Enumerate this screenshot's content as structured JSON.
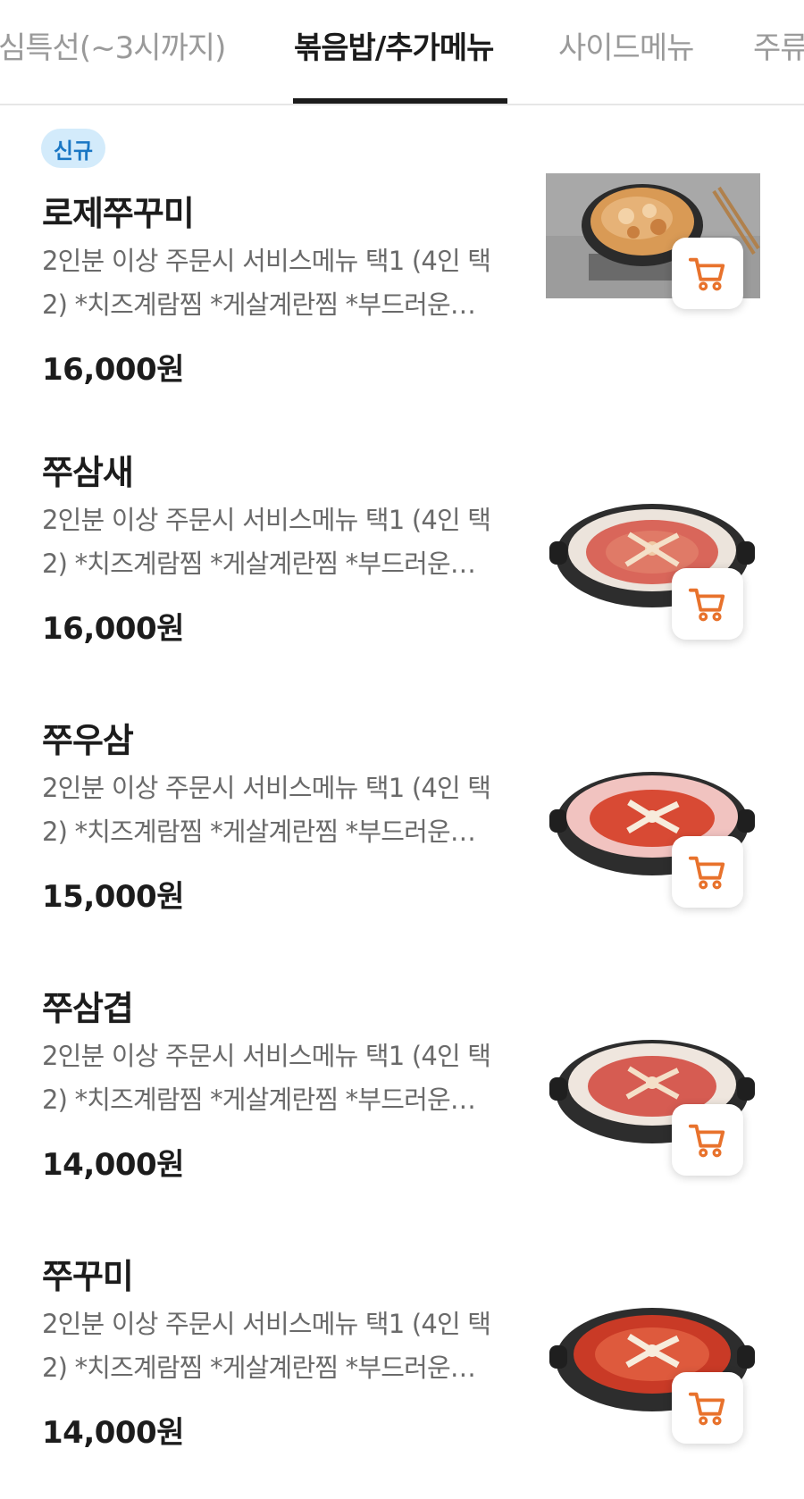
{
  "tabs": [
    {
      "label": "심특선(~3시까지)",
      "active": false
    },
    {
      "label": "볶음밥/추가메뉴",
      "active": true
    },
    {
      "label": "사이드메뉴",
      "active": false
    },
    {
      "label": "주류",
      "active": false
    }
  ],
  "colors": {
    "accent": "#e8722c",
    "badge_bg": "#d3ebfb",
    "badge_text": "#1a77c4",
    "active_tab": "#1b1b1b",
    "inactive_tab": "#9a9a9a"
  },
  "menu": {
    "items": [
      {
        "badge": "신규",
        "name": "로제쭈꾸미",
        "desc_line1": "2인분 이상 주문시 서비스메뉴 택1 (4인 택",
        "desc_line2": "2) *치즈계람찜 *게살계란찜 *부드러운…",
        "price": "16,000원",
        "image_icon": "rose-jjukkumi-dish-image",
        "cart_icon": "cart-icon"
      },
      {
        "name": "쭈삼새",
        "desc_line1": "2인분 이상 주문시 서비스메뉴 택1 (4인 택",
        "desc_line2": "2) *치즈계람찜 *게살계란찜 *부드러운…",
        "price": "16,000원",
        "image_icon": "jjusamsae-dish-image",
        "cart_icon": "cart-icon"
      },
      {
        "name": "쭈우삼",
        "desc_line1": "2인분 이상 주문시 서비스메뉴 택1 (4인 택",
        "desc_line2": "2) *치즈계람찜 *게살계란찜 *부드러운…",
        "price": "15,000원",
        "image_icon": "jjuusam-dish-image",
        "cart_icon": "cart-icon"
      },
      {
        "name": "쭈삼겹",
        "desc_line1": "2인분 이상 주문시 서비스메뉴 택1 (4인 택",
        "desc_line2": "2) *치즈계람찜 *게살계란찜 *부드러운…",
        "price": "14,000원",
        "image_icon": "jjusamgyeop-dish-image",
        "cart_icon": "cart-icon"
      },
      {
        "name": "쭈꾸미",
        "desc_line1": "2인분 이상 주문시 서비스메뉴 택1 (4인 택",
        "desc_line2": "2) *치즈계람찜 *게살계란찜 *부드러운…",
        "price": "14,000원",
        "image_icon": "jjukkumi-dish-image",
        "cart_icon": "cart-icon"
      }
    ]
  }
}
